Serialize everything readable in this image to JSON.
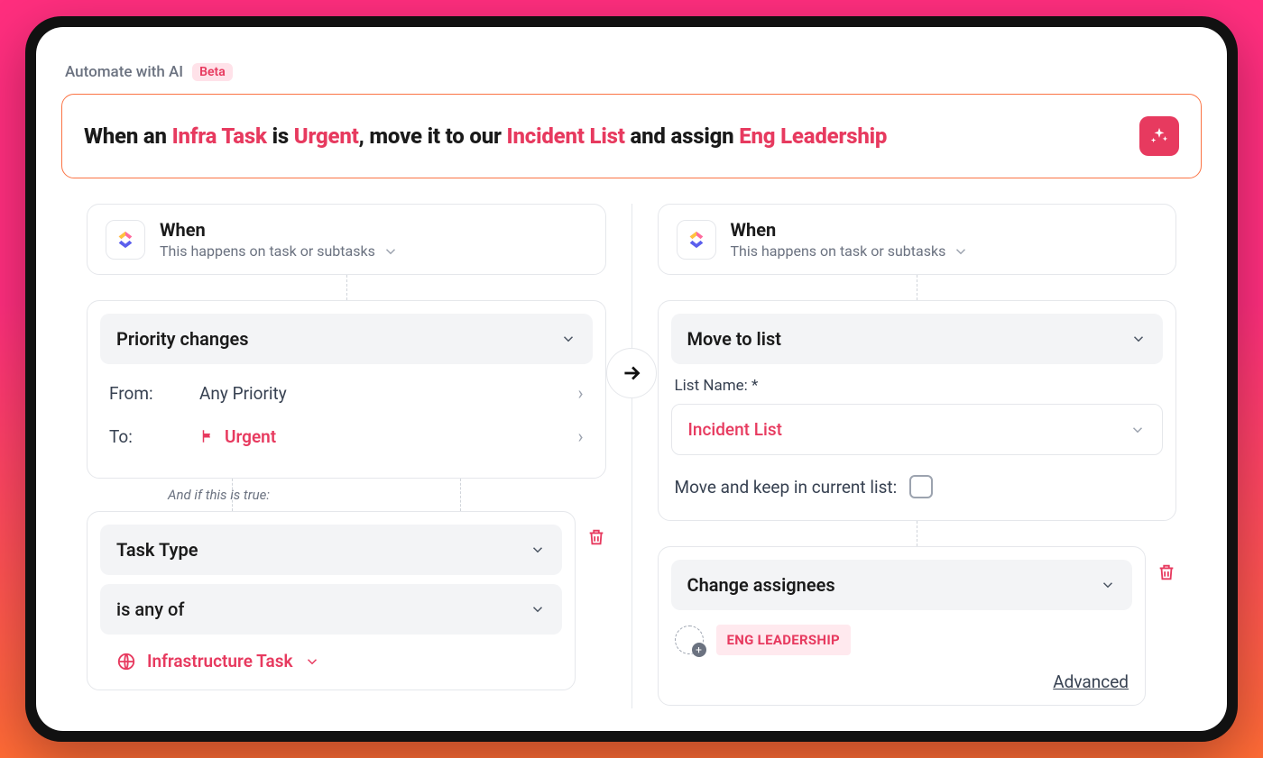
{
  "header": {
    "title": "Automate with AI",
    "badge": "Beta"
  },
  "prompt": {
    "parts": [
      {
        "t": "When an ",
        "hl": false
      },
      {
        "t": "Infra Task",
        "hl": true
      },
      {
        "t": " is ",
        "hl": false
      },
      {
        "t": "Urgent",
        "hl": true
      },
      {
        "t": ", move it to our ",
        "hl": false
      },
      {
        "t": "Incident List",
        "hl": true
      },
      {
        "t": " and assign ",
        "hl": false
      },
      {
        "t": "Eng Leadership",
        "hl": true
      }
    ]
  },
  "left": {
    "when": {
      "title": "When",
      "subtitle": "This happens on task or subtasks"
    },
    "trigger": {
      "label": "Priority changes",
      "from_key": "From:",
      "from_val": "Any Priority",
      "to_key": "To:",
      "to_val": "Urgent"
    },
    "and_if": "And if this is true:",
    "condition": {
      "field": "Task Type",
      "operator": "is any of",
      "value": "Infrastructure Task"
    }
  },
  "right": {
    "when": {
      "title": "When",
      "subtitle": "This happens on task or subtasks"
    },
    "action1": {
      "label": "Move to list",
      "field_label": "List Name: *",
      "list_value": "Incident List",
      "keep_label": "Move and keep in current list:"
    },
    "action2": {
      "label": "Change assignees",
      "assignee": "ENG LEADERSHIP",
      "advanced": "Advanced"
    }
  }
}
